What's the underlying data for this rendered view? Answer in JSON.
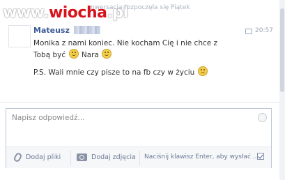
{
  "watermark": {
    "prefix": "www.",
    "brand": "wiocha",
    "suffix": ".pl"
  },
  "conversation_note": "nwersacja rozpoczęła się Piątek",
  "message": {
    "sender": "Mateusz",
    "time": "20:57",
    "line1": "Monika z nami koniec. Nie kocham Cię i nie chce z",
    "line2a": "Tobą być",
    "line2b": "Nara",
    "line3": "P.S. Wali mnie czy pisze to na fb czy w życiu"
  },
  "reply": {
    "placeholder": "Napisz odpowiedź...",
    "add_files": "Dodaj pliki",
    "add_photo": "Dodaj zdjęcia",
    "enter_hint": "Naciśnij klawisz Enter, aby wysłać ..."
  },
  "icons": {
    "paperclip": "paperclip-icon",
    "camera": "camera-icon",
    "smiley": "smiley-icon",
    "chat": "chat-bubble-icon"
  },
  "colors": {
    "link": "#3b5998",
    "watermark_red": "#d6141b",
    "border": "#bdc7d8"
  }
}
